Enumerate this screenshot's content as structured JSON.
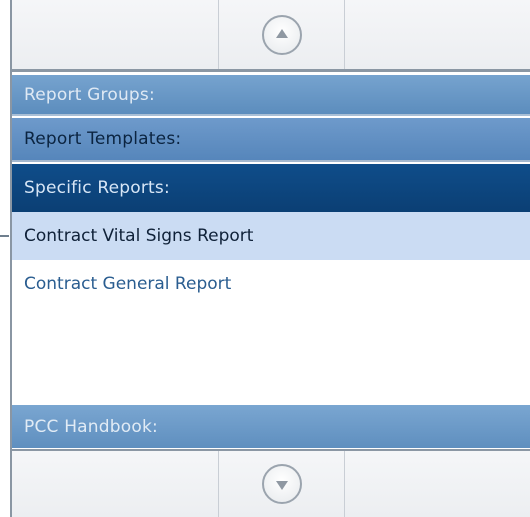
{
  "scroll": {
    "up_icon": "chevron-up-circle-icon",
    "down_icon": "chevron-down-circle-icon"
  },
  "sections": {
    "report_groups": "Report Groups:",
    "report_templates": "Report Templates:",
    "specific_reports": "Specific Reports:",
    "pcc_handbook": "PCC Handbook:"
  },
  "specific_reports_items": [
    {
      "label": "Contract Vital Signs Report",
      "selected": true
    },
    {
      "label": "Contract General Report",
      "selected": false
    }
  ],
  "colors": {
    "selected_header": "#0b3f74",
    "header": "#5c8dbd",
    "selected_item_bg": "#cbdcf3",
    "link_text": "#2a5d90"
  }
}
